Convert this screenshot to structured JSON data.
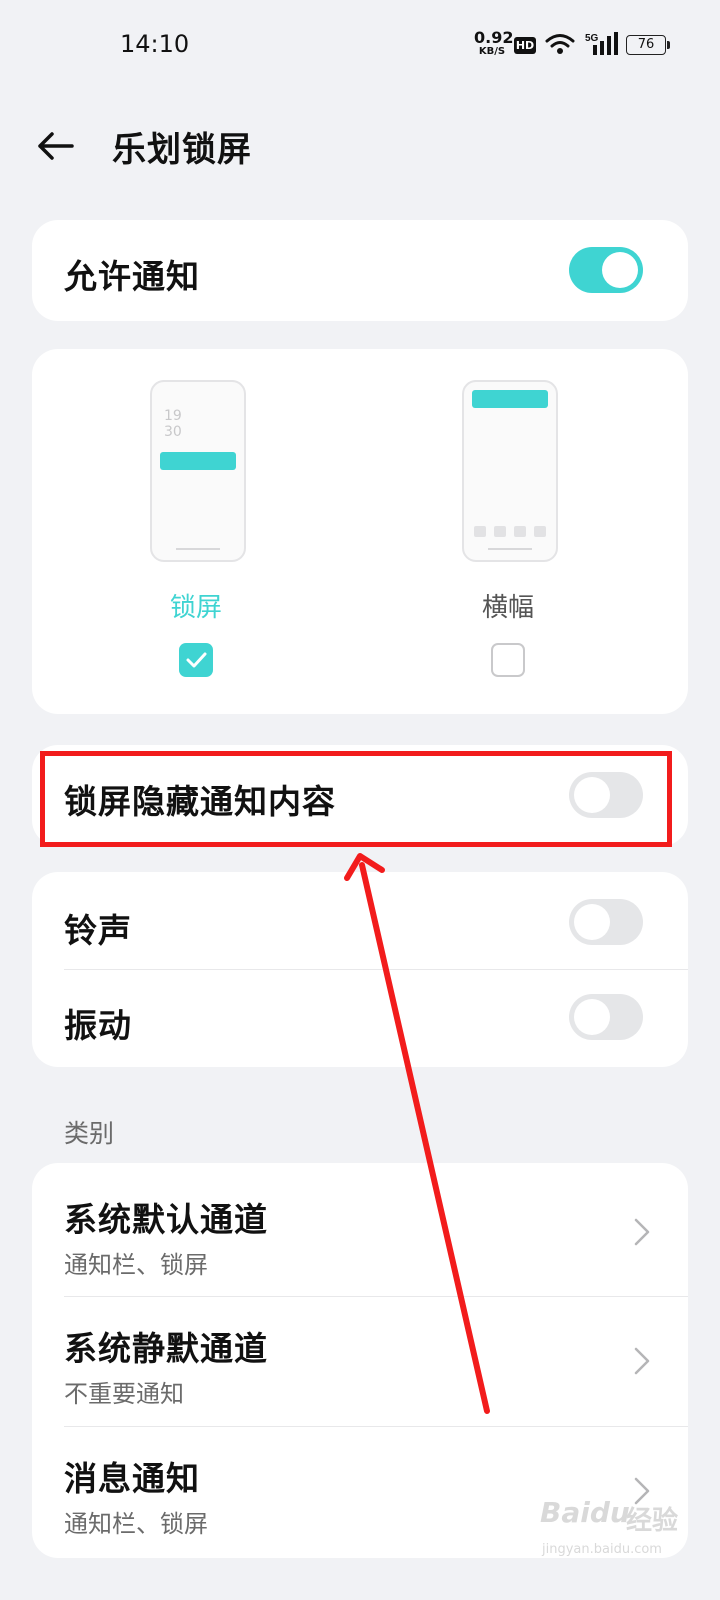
{
  "status_bar": {
    "time": "14:10",
    "net_speed_value": "0.92",
    "net_speed_unit": "KB/S",
    "hd_badge": "HD",
    "network": "5G",
    "battery": "76",
    "icons": [
      "wifi-icon",
      "signal-icon",
      "battery-icon"
    ]
  },
  "header": {
    "title": "乐划锁屏",
    "back_icon": "arrow-left-icon"
  },
  "allow_notifications": {
    "label": "允许通知",
    "enabled": true
  },
  "styles": {
    "lock_screen": {
      "label": "锁屏",
      "checked": true,
      "preview_clock_hour": "19",
      "preview_clock_minute": "30"
    },
    "banner": {
      "label": "横幅",
      "checked": false
    }
  },
  "hide_content": {
    "label": "锁屏隐藏通知内容",
    "enabled": false
  },
  "sound_vibration": {
    "ringtone_label": "铃声",
    "ringtone_enabled": false,
    "vibration_label": "振动",
    "vibration_enabled": false
  },
  "categories": {
    "header": "类别",
    "items": [
      {
        "title": "系统默认通道",
        "subtitle": "通知栏、锁屏"
      },
      {
        "title": "系统静默通道",
        "subtitle": "不重要通知"
      },
      {
        "title": "消息通知",
        "subtitle": "通知栏、锁屏"
      }
    ]
  },
  "watermark": {
    "logo": "Baidu",
    "text": "经验",
    "url": "jingyan.baidu.com"
  },
  "colors": {
    "accent": "#3fd4d2",
    "annotation": "#f21c1c",
    "background": "#f1f2f5"
  }
}
